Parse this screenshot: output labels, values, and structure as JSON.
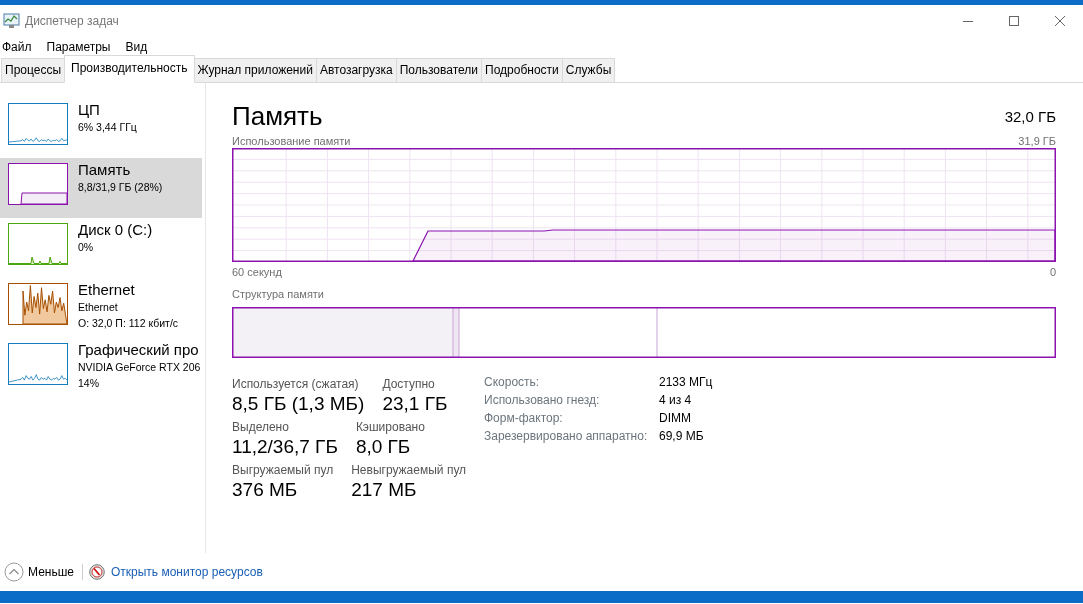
{
  "window": {
    "title": "Диспетчер задач"
  },
  "menu": [
    "Файл",
    "Параметры",
    "Вид"
  ],
  "tabs": [
    {
      "label": "Процессы",
      "selected": false
    },
    {
      "label": "Производительность",
      "selected": true
    },
    {
      "label": "Журнал приложений",
      "selected": false
    },
    {
      "label": "Автозагрузка",
      "selected": false
    },
    {
      "label": "Пользователи",
      "selected": false
    },
    {
      "label": "Подробности",
      "selected": false
    },
    {
      "label": "Службы",
      "selected": false
    }
  ],
  "sidebar": {
    "items": [
      {
        "kind": "cpu",
        "name": "ЦП",
        "details": [
          "6% 3,44 ГГц"
        ],
        "color": "#117dbb",
        "selected": false
      },
      {
        "kind": "memory",
        "name": "Память",
        "details": [
          "8,8/31,9 ГБ (28%)"
        ],
        "color": "#8b12ae",
        "selected": true
      },
      {
        "kind": "disk",
        "name": "Диск 0 (C:)",
        "details": [
          "0%"
        ],
        "color": "#4da60c",
        "selected": false
      },
      {
        "kind": "network",
        "name": "Ethernet",
        "details": [
          "Ethernet",
          "О: 32,0 П: 112 кбит/с"
        ],
        "color": "#a74f01",
        "selected": false
      },
      {
        "kind": "gpu",
        "name": "Графический про",
        "details": [
          "NVIDIA GeForce RTX 206",
          "14%"
        ],
        "color": "#117dbb",
        "selected": false
      }
    ]
  },
  "detail": {
    "title": "Память",
    "total": "32,0 ГБ",
    "graph": {
      "label": "Использование памяти",
      "max": "31,9 ГБ",
      "start": "60 секунд",
      "end": "0"
    },
    "composition": {
      "label": "Структура памяти"
    },
    "stats": [
      {
        "label": "Используется (сжатая)",
        "value": "8,5 ГБ (1,3 МБ)"
      },
      {
        "label": "Доступно",
        "value": "23,1 ГБ"
      },
      {
        "label": "Выделено",
        "value": "11,2/36,7 ГБ"
      },
      {
        "label": "Кэшировано",
        "value": "8,0 ГБ"
      },
      {
        "label": "Выгружаемый пул",
        "value": "376 МБ"
      },
      {
        "label": "Невыгружаемый пул",
        "value": "217 МБ"
      }
    ],
    "properties": [
      {
        "label": "Скорость:",
        "value": "2133 МГц"
      },
      {
        "label": "Использовано гнезд:",
        "value": "4 из 4"
      },
      {
        "label": "Форм-фактор:",
        "value": "DIMM"
      },
      {
        "label": "Зарезервировано аппаратно:",
        "value": "69,9 МБ"
      }
    ]
  },
  "footer": {
    "less": "Меньше",
    "monitor": "Открыть монитор ресурсов"
  }
}
